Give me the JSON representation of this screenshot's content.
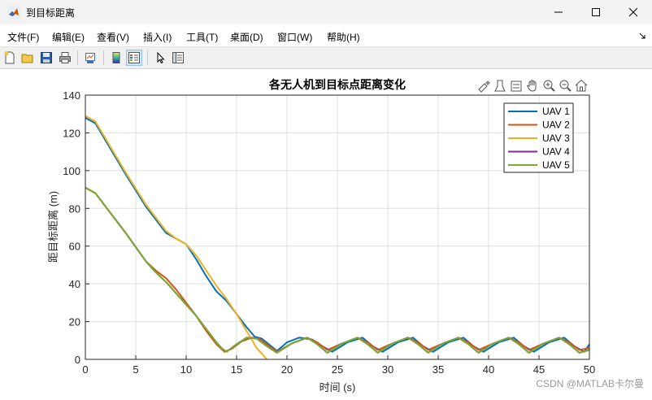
{
  "window": {
    "title": "到目标距离"
  },
  "menu": [
    {
      "label": "文件(F)"
    },
    {
      "label": "编辑(E)"
    },
    {
      "label": "查看(V)"
    },
    {
      "label": "插入(I)"
    },
    {
      "label": "工具(T)"
    },
    {
      "label": "桌面(D)"
    },
    {
      "label": "窗口(W)"
    },
    {
      "label": "帮助(H)"
    }
  ],
  "toolbar_icons": [
    "new-figure-icon",
    "open-file-icon",
    "save-icon",
    "print-icon",
    "link-plot-icon",
    "colorbar-icon",
    "legend-icon",
    "pointer-icon",
    "property-inspector-icon"
  ],
  "axes_toolbar_icons": [
    "brush-icon",
    "data-tips-icon",
    "zoom-menu-icon",
    "pan-icon",
    "zoom-in-icon",
    "zoom-out-icon",
    "home-icon"
  ],
  "watermark": "CSDN @MATLAB卡尔曼",
  "colors": {
    "uav1": "#0072BD",
    "uav2": "#D95319",
    "uav3": "#EDB120",
    "uav4": "#7E2F8E",
    "uav5": "#77AC30",
    "grid": "#dfdfdf"
  },
  "chart_data": {
    "type": "line",
    "title": "各无人机到目标点距离变化",
    "xlabel": "时间 (s)",
    "ylabel": "距目标距离 (m)",
    "xlim": [
      0,
      50
    ],
    "ylim": [
      0,
      140
    ],
    "xticks": [
      0,
      5,
      10,
      15,
      20,
      25,
      30,
      35,
      40,
      45,
      50
    ],
    "yticks": [
      0,
      20,
      40,
      60,
      80,
      100,
      120,
      140
    ],
    "grid": true,
    "legend_position": "top-right",
    "series": [
      {
        "name": "UAV 1",
        "x": [
          0,
          1,
          2,
          4,
          6,
          8,
          9,
          10,
          11,
          12,
          13,
          14,
          15,
          16,
          16.8,
          17.5,
          18.2,
          19,
          20,
          21.2,
          22.5,
          23.5,
          24.5,
          26,
          27.5,
          28.5,
          29.5,
          31,
          32.5,
          33.5,
          34.5,
          36,
          37.5,
          38.5,
          39.5,
          41,
          42.5,
          43.5,
          44.5,
          46,
          47.5,
          48.5,
          49.5,
          50
        ],
        "y": [
          128,
          125,
          116,
          98,
          81,
          67,
          64,
          61,
          53,
          44,
          36,
          31,
          24,
          17,
          12,
          11,
          8,
          4.5,
          9,
          11.5,
          10.5,
          7,
          4,
          9,
          11.5,
          7,
          4,
          9,
          11.5,
          7,
          4,
          9,
          11.5,
          7,
          4,
          9,
          11.5,
          7,
          4,
          9,
          11.5,
          7,
          4,
          8
        ]
      },
      {
        "name": "UAV 2",
        "x": [
          0,
          1,
          2,
          4,
          6,
          7,
          8,
          9,
          10,
          11,
          12,
          13,
          13.8,
          14.5,
          15.5,
          16.5,
          17.2,
          18,
          19,
          20.5,
          22,
          23,
          24,
          25.5,
          27,
          28,
          29,
          30.5,
          32,
          33,
          34,
          35.5,
          37,
          38,
          39,
          40.5,
          42,
          43,
          44,
          45.5,
          47,
          48,
          49,
          50
        ],
        "y": [
          91,
          88,
          81,
          67,
          52,
          47,
          43,
          37,
          30,
          23,
          15,
          8,
          4,
          5.5,
          9.5,
          11.5,
          11,
          8,
          4,
          8.5,
          11.5,
          9,
          5,
          8.5,
          11.5,
          9,
          5,
          8.5,
          11.5,
          9,
          5,
          8.5,
          11.5,
          9,
          5,
          8.5,
          11.5,
          9,
          5,
          8.5,
          11.5,
          9,
          5,
          6
        ]
      },
      {
        "name": "UAV 3",
        "x": [
          0,
          1,
          2,
          4,
          6,
          8,
          9,
          10,
          11,
          12,
          13,
          14,
          15,
          16,
          17,
          18
        ],
        "y": [
          129,
          126,
          117,
          99,
          82,
          68,
          64,
          61,
          55,
          47,
          39,
          32,
          24,
          15,
          6,
          0
        ]
      },
      {
        "name": "UAV 4",
        "x": [
          0,
          1,
          2,
          4,
          6,
          7,
          8,
          9,
          10,
          11,
          12,
          13,
          13.5,
          14,
          15,
          16,
          17,
          18,
          19,
          20.5,
          22,
          23,
          24,
          25.5,
          27,
          28,
          29,
          30.5,
          32,
          33,
          34,
          35.5,
          37,
          38,
          39,
          40.5,
          42,
          43,
          44,
          45.5,
          47,
          48,
          49,
          50
        ],
        "y": [
          91,
          88,
          81,
          67,
          52,
          46,
          41,
          35,
          29,
          23,
          16,
          9,
          6,
          4,
          8,
          11.5,
          11,
          7,
          3.5,
          8.5,
          11.5,
          8,
          3.5,
          8.5,
          11.5,
          8,
          3.5,
          8.5,
          11.5,
          8,
          3.5,
          8.5,
          11.5,
          8,
          3.5,
          8.5,
          11.5,
          8,
          3.5,
          8.5,
          11.5,
          8,
          3.5,
          5
        ]
      },
      {
        "name": "UAV 5",
        "x": [
          0,
          1,
          2,
          4,
          6,
          7,
          8,
          9,
          10,
          11,
          12,
          13,
          13.5,
          14,
          15,
          16,
          17,
          18,
          19,
          20.5,
          22,
          23,
          24,
          25.5,
          27,
          28,
          29,
          30.5,
          32,
          33,
          34,
          35.5,
          37,
          38,
          39,
          40.5,
          42,
          43,
          44,
          45.5,
          47,
          48,
          49,
          50
        ],
        "y": [
          91,
          88,
          81,
          67,
          52,
          46,
          41,
          35,
          29,
          23,
          16,
          9,
          6,
          4,
          8,
          11.5,
          11,
          7,
          3.5,
          8.5,
          11.5,
          8,
          3.5,
          8.5,
          11.5,
          8,
          3.5,
          8.5,
          11.5,
          8,
          3.5,
          8.5,
          11.5,
          8,
          3.5,
          8.5,
          11.5,
          8,
          3.5,
          8.5,
          11.5,
          8,
          3.5,
          5
        ]
      }
    ]
  }
}
